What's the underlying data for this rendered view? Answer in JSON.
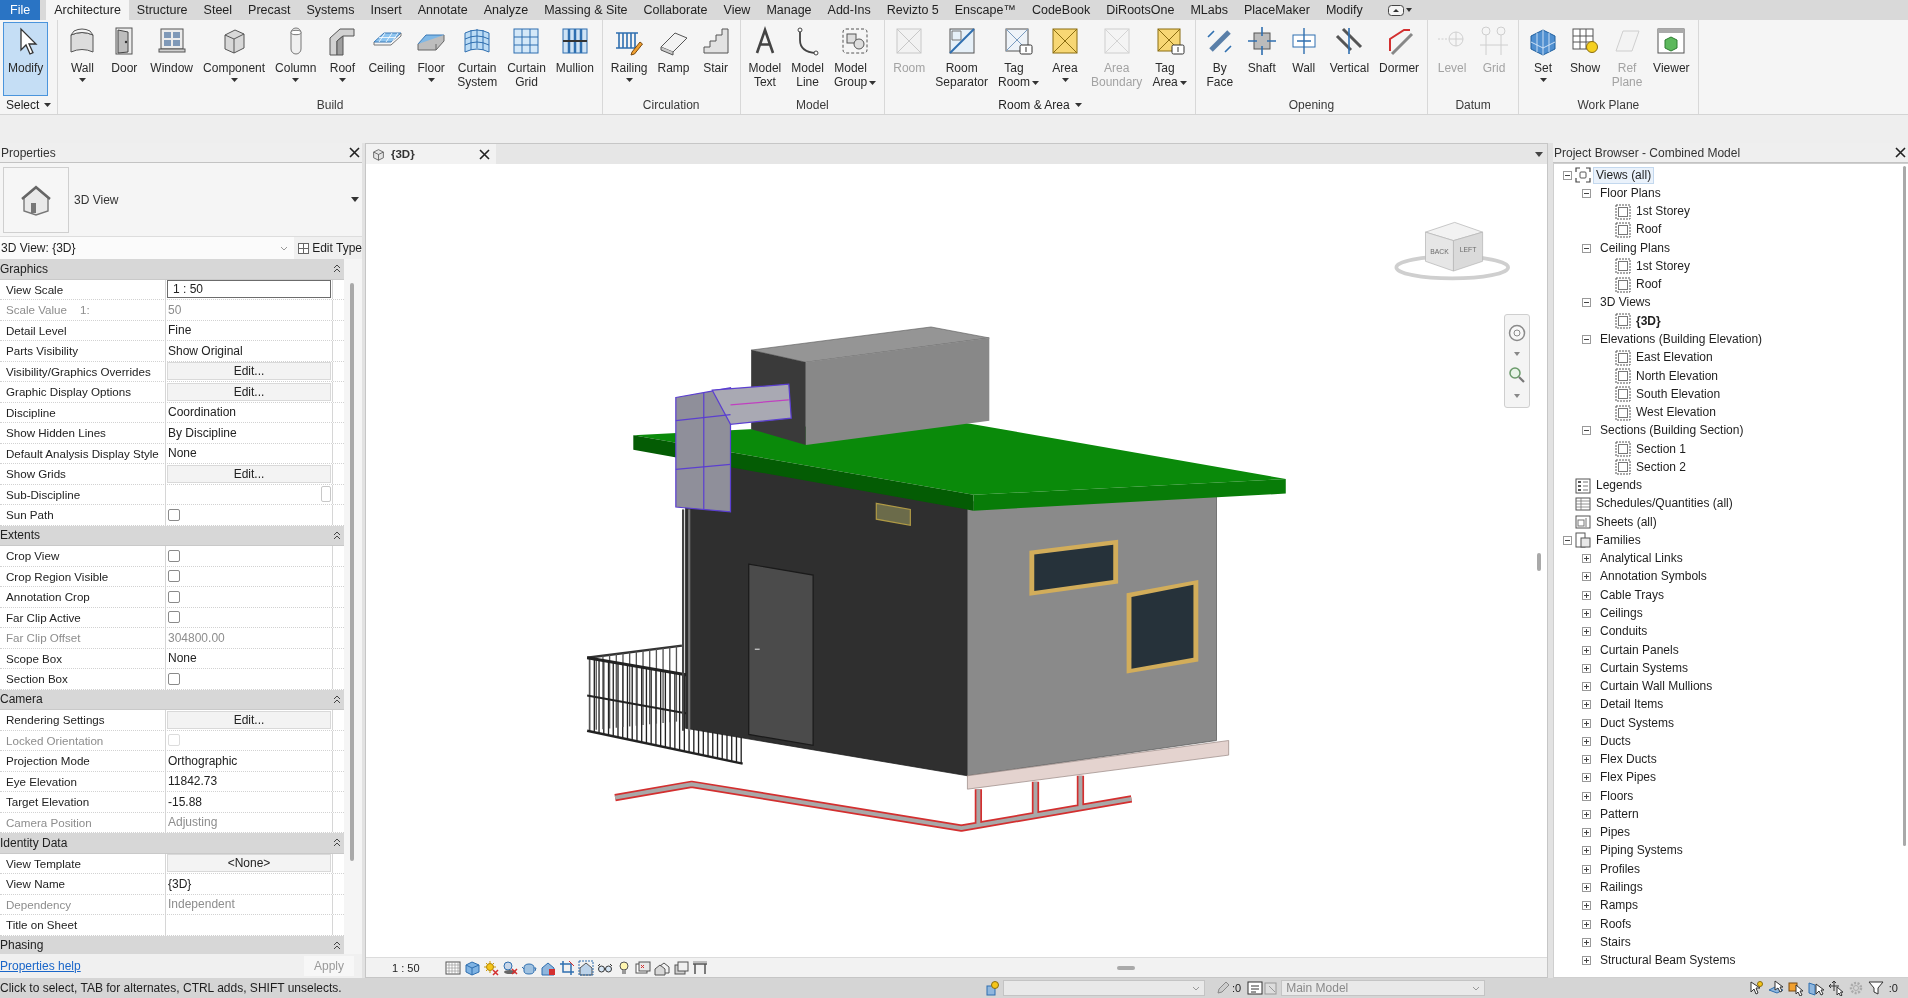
{
  "menu_tabs": [
    {
      "label": "File",
      "kind": "file",
      "selected": false
    },
    {
      "label": "Architecture",
      "kind": "tab",
      "selected": true
    },
    {
      "label": "Structure",
      "kind": "tab",
      "selected": false
    },
    {
      "label": "Steel",
      "kind": "tab",
      "selected": false
    },
    {
      "label": "Precast",
      "kind": "tab",
      "selected": false
    },
    {
      "label": "Systems",
      "kind": "tab",
      "selected": false
    },
    {
      "label": "Insert",
      "kind": "tab",
      "selected": false
    },
    {
      "label": "Annotate",
      "kind": "tab",
      "selected": false
    },
    {
      "label": "Analyze",
      "kind": "tab",
      "selected": false
    },
    {
      "label": "Massing & Site",
      "kind": "tab",
      "selected": false
    },
    {
      "label": "Collaborate",
      "kind": "tab",
      "selected": false
    },
    {
      "label": "View",
      "kind": "tab",
      "selected": false
    },
    {
      "label": "Manage",
      "kind": "tab",
      "selected": false
    },
    {
      "label": "Add-Ins",
      "kind": "tab",
      "selected": false
    },
    {
      "label": "Revizto 5",
      "kind": "tab",
      "selected": false
    },
    {
      "label": "Enscape™",
      "kind": "tab",
      "selected": false
    },
    {
      "label": "CodeBook",
      "kind": "tab",
      "selected": false
    },
    {
      "label": "DiRootsOne",
      "kind": "tab",
      "selected": false
    },
    {
      "label": "MLabs",
      "kind": "tab",
      "selected": false
    },
    {
      "label": "PlaceMaker",
      "kind": "tab",
      "selected": false
    },
    {
      "label": "Modify",
      "kind": "tab",
      "selected": false
    }
  ],
  "ribbon_panels": [
    {
      "title": "Select",
      "menu": true,
      "buttons": [
        {
          "label": "Modify",
          "active": true,
          "disabled": false,
          "dropdown": false
        }
      ]
    },
    {
      "title": "Build",
      "menu": false,
      "buttons": [
        {
          "label": "Wall",
          "active": false,
          "disabled": false,
          "dropdown": true
        },
        {
          "label": "Door",
          "active": false,
          "disabled": false,
          "dropdown": false
        },
        {
          "label": "Window",
          "active": false,
          "disabled": false,
          "dropdown": false
        },
        {
          "label": "Component",
          "active": false,
          "disabled": false,
          "dropdown": true
        },
        {
          "label": "Column",
          "active": false,
          "disabled": false,
          "dropdown": true
        },
        {
          "label": "Roof",
          "active": false,
          "disabled": false,
          "dropdown": true
        },
        {
          "label": "Ceiling",
          "active": false,
          "disabled": false,
          "dropdown": false
        },
        {
          "label": "Floor",
          "active": false,
          "disabled": false,
          "dropdown": true
        },
        {
          "label": "Curtain System",
          "active": false,
          "disabled": false,
          "dropdown": false
        },
        {
          "label": "Curtain Grid",
          "active": false,
          "disabled": false,
          "dropdown": false
        },
        {
          "label": "Mullion",
          "active": false,
          "disabled": false,
          "dropdown": false
        }
      ]
    },
    {
      "title": "Circulation",
      "menu": false,
      "buttons": [
        {
          "label": "Railing",
          "active": false,
          "disabled": false,
          "dropdown": true
        },
        {
          "label": "Ramp",
          "active": false,
          "disabled": false,
          "dropdown": false
        },
        {
          "label": "Stair",
          "active": false,
          "disabled": false,
          "dropdown": false
        }
      ]
    },
    {
      "title": "Model",
      "menu": false,
      "buttons": [
        {
          "label": "Model Text",
          "active": false,
          "disabled": false,
          "dropdown": false
        },
        {
          "label": "Model Line",
          "active": false,
          "disabled": false,
          "dropdown": false
        },
        {
          "label": "Model Group",
          "active": false,
          "disabled": false,
          "dropdown": true
        }
      ]
    },
    {
      "title": "Room & Area",
      "menu": true,
      "buttons": [
        {
          "label": "Room",
          "active": false,
          "disabled": true,
          "dropdown": false
        },
        {
          "label": "Room Separator",
          "active": false,
          "disabled": false,
          "dropdown": false
        },
        {
          "label": "Tag Room",
          "active": false,
          "disabled": false,
          "dropdown": true
        },
        {
          "label": "Area",
          "active": false,
          "disabled": false,
          "dropdown": true
        },
        {
          "label": "Area Boundary",
          "active": false,
          "disabled": true,
          "dropdown": false
        },
        {
          "label": "Tag Area",
          "active": false,
          "disabled": false,
          "dropdown": true
        }
      ]
    },
    {
      "title": "Opening",
      "menu": false,
      "buttons": [
        {
          "label": "By Face",
          "active": false,
          "disabled": false,
          "dropdown": false
        },
        {
          "label": "Shaft",
          "active": false,
          "disabled": false,
          "dropdown": false
        },
        {
          "label": "Wall",
          "active": false,
          "disabled": false,
          "dropdown": false
        },
        {
          "label": "Vertical",
          "active": false,
          "disabled": false,
          "dropdown": false
        },
        {
          "label": "Dormer",
          "active": false,
          "disabled": false,
          "dropdown": false
        }
      ]
    },
    {
      "title": "Datum",
      "menu": false,
      "buttons": [
        {
          "label": "Level",
          "active": false,
          "disabled": true,
          "dropdown": false
        },
        {
          "label": "Grid",
          "active": false,
          "disabled": true,
          "dropdown": false
        }
      ]
    },
    {
      "title": "Work Plane",
      "menu": false,
      "buttons": [
        {
          "label": "Set",
          "active": false,
          "disabled": false,
          "dropdown": true
        },
        {
          "label": "Show",
          "active": false,
          "disabled": false,
          "dropdown": false
        },
        {
          "label": "Ref Plane",
          "active": false,
          "disabled": true,
          "dropdown": false
        },
        {
          "label": "Viewer",
          "active": false,
          "disabled": false,
          "dropdown": false
        }
      ]
    }
  ],
  "properties": {
    "title": "Properties",
    "type_name": "3D View",
    "instance": "3D View: {3D}",
    "edit_type": "Edit Type",
    "groups": [
      {
        "title": "Graphics",
        "expanded": true,
        "rows": [
          {
            "label": "View Scale",
            "kind": "input",
            "value": "1 : 50",
            "disabled": false
          },
          {
            "label": "Scale Value",
            "unit": "1:",
            "kind": "text",
            "value": "50",
            "disabled": true
          },
          {
            "label": "Detail Level",
            "kind": "text",
            "value": "Fine",
            "disabled": false
          },
          {
            "label": "Parts Visibility",
            "kind": "text",
            "value": "Show Original",
            "disabled": false
          },
          {
            "label": "Visibility/Graphics Overrides",
            "kind": "button",
            "value": "Edit...",
            "disabled": false
          },
          {
            "label": "Graphic Display Options",
            "kind": "button",
            "value": "Edit...",
            "disabled": false
          },
          {
            "label": "Discipline",
            "kind": "text",
            "value": "Coordination",
            "disabled": false
          },
          {
            "label": "Show Hidden Lines",
            "kind": "text",
            "value": "By Discipline",
            "disabled": false
          },
          {
            "label": "Default Analysis Display Style",
            "kind": "text",
            "value": "None",
            "disabled": false
          },
          {
            "label": "Show Grids",
            "kind": "button",
            "value": "Edit...",
            "disabled": false
          },
          {
            "label": "Sub-Discipline",
            "kind": "select",
            "disabled": false
          },
          {
            "label": "Sun Path",
            "kind": "checkbox",
            "checked": false,
            "disabled": false
          }
        ]
      },
      {
        "title": "Extents",
        "expanded": true,
        "rows": [
          {
            "label": "Crop View",
            "kind": "checkbox",
            "checked": false,
            "disabled": false
          },
          {
            "label": "Crop Region Visible",
            "kind": "checkbox",
            "checked": false,
            "disabled": false
          },
          {
            "label": "Annotation Crop",
            "kind": "checkbox",
            "checked": false,
            "disabled": false
          },
          {
            "label": "Far Clip Active",
            "kind": "checkbox",
            "checked": false,
            "disabled": false
          },
          {
            "label": "Far Clip Offset",
            "kind": "text",
            "value": "304800.00",
            "disabled": true
          },
          {
            "label": "Scope Box",
            "kind": "text",
            "value": "None",
            "disabled": false
          },
          {
            "label": "Section Box",
            "kind": "checkbox",
            "checked": false,
            "disabled": false
          }
        ]
      },
      {
        "title": "Camera",
        "expanded": true,
        "rows": [
          {
            "label": "Rendering Settings",
            "kind": "button",
            "value": "Edit...",
            "disabled": false
          },
          {
            "label": "Locked Orientation",
            "kind": "checkbox",
            "checked": false,
            "disabled": true
          },
          {
            "label": "Projection Mode",
            "kind": "text",
            "value": "Orthographic",
            "disabled": false
          },
          {
            "label": "Eye Elevation",
            "kind": "text",
            "value": "11842.73",
            "disabled": false
          },
          {
            "label": "Target Elevation",
            "kind": "text",
            "value": "-15.88",
            "disabled": false
          },
          {
            "label": "Camera Position",
            "kind": "text",
            "value": "Adjusting",
            "disabled": true
          }
        ]
      },
      {
        "title": "Identity Data",
        "expanded": true,
        "rows": [
          {
            "label": "View Template",
            "kind": "button",
            "value": "<None>",
            "disabled": false
          },
          {
            "label": "View Name",
            "kind": "text",
            "value": "{3D}",
            "disabled": false
          },
          {
            "label": "Dependency",
            "kind": "text",
            "value": "Independent",
            "disabled": true
          },
          {
            "label": "Title on Sheet",
            "kind": "text",
            "disabled": false
          }
        ]
      },
      {
        "title": "Phasing",
        "expanded": true
      }
    ],
    "help": "Properties help",
    "apply": {
      "label": "Apply",
      "disabled": true
    }
  },
  "view": {
    "tab": "{3D}",
    "cube_faces": [
      "BACK",
      "LEFT"
    ],
    "scale": "1 : 50"
  },
  "project_browser": {
    "title": "Project Browser - Combined Model",
    "tree": [
      {
        "label": "Views (all)",
        "kind": "views",
        "expanded": true,
        "selected": true,
        "children": [
          {
            "label": "Floor Plans",
            "expanded": true,
            "selected": false,
            "children": [
              {
                "label": "1st Storey",
                "open": false,
                "selected": false
              },
              {
                "label": "Roof",
                "open": false,
                "selected": false
              }
            ]
          },
          {
            "label": "Ceiling Plans",
            "expanded": true,
            "selected": false,
            "children": [
              {
                "label": "1st Storey",
                "open": false,
                "selected": false
              },
              {
                "label": "Roof",
                "open": false,
                "selected": false
              }
            ]
          },
          {
            "label": "3D Views",
            "expanded": true,
            "selected": false,
            "children": [
              {
                "label": "{3D}",
                "open": true,
                "selected": false
              }
            ]
          },
          {
            "label": "Elevations (Building Elevation)",
            "expanded": true,
            "selected": false,
            "children": [
              {
                "label": "East Elevation",
                "open": false,
                "selected": false
              },
              {
                "label": "North Elevation",
                "open": false,
                "selected": false
              },
              {
                "label": "South Elevation",
                "open": false,
                "selected": false
              },
              {
                "label": "West Elevation",
                "open": false,
                "selected": false
              }
            ]
          },
          {
            "label": "Sections (Building Section)",
            "expanded": true,
            "selected": false,
            "children": [
              {
                "label": "Section 1",
                "open": false,
                "selected": false
              },
              {
                "label": "Section 2",
                "open": false,
                "selected": false
              }
            ]
          }
        ]
      },
      {
        "label": "Legends",
        "kind": "legends",
        "selected": false
      },
      {
        "label": "Schedules/Quantities (all)",
        "kind": "schedules",
        "selected": false
      },
      {
        "label": "Sheets (all)",
        "kind": "sheets",
        "selected": false
      },
      {
        "label": "Families",
        "kind": "families",
        "expanded": true,
        "selected": false,
        "children": [
          {
            "label": "Analytical Links",
            "expanded": false,
            "selected": false
          },
          {
            "label": "Annotation Symbols",
            "expanded": false,
            "selected": false
          },
          {
            "label": "Cable Trays",
            "expanded": false,
            "selected": false
          },
          {
            "label": "Ceilings",
            "expanded": false,
            "selected": false
          },
          {
            "label": "Conduits",
            "expanded": false,
            "selected": false
          },
          {
            "label": "Curtain Panels",
            "expanded": false,
            "selected": false
          },
          {
            "label": "Curtain Systems",
            "expanded": false,
            "selected": false
          },
          {
            "label": "Curtain Wall Mullions",
            "expanded": false,
            "selected": false
          },
          {
            "label": "Detail Items",
            "expanded": false,
            "selected": false
          },
          {
            "label": "Duct Systems",
            "expanded": false,
            "selected": false
          },
          {
            "label": "Ducts",
            "expanded": false,
            "selected": false
          },
          {
            "label": "Flex Ducts",
            "expanded": false,
            "selected": false
          },
          {
            "label": "Flex Pipes",
            "expanded": false,
            "selected": false
          },
          {
            "label": "Floors",
            "expanded": false,
            "selected": false
          },
          {
            "label": "Pattern",
            "expanded": false,
            "selected": false
          },
          {
            "label": "Pipes",
            "expanded": false,
            "selected": false
          },
          {
            "label": "Piping Systems",
            "expanded": false,
            "selected": false
          },
          {
            "label": "Profiles",
            "expanded": false,
            "selected": false
          },
          {
            "label": "Railings",
            "expanded": false,
            "selected": false
          },
          {
            "label": "Ramps",
            "expanded": false,
            "selected": false
          },
          {
            "label": "Roofs",
            "expanded": false,
            "selected": false
          },
          {
            "label": "Stairs",
            "expanded": false,
            "selected": false
          },
          {
            "label": "Structural Beam Systems",
            "expanded": false,
            "selected": false
          }
        ]
      }
    ]
  },
  "status_bar": {
    "message": "Click to select, TAB for alternates, CTRL adds, SHIFT unselects.",
    "editable_count": ":0",
    "model": "Main Model",
    "filter_count": ":0"
  }
}
